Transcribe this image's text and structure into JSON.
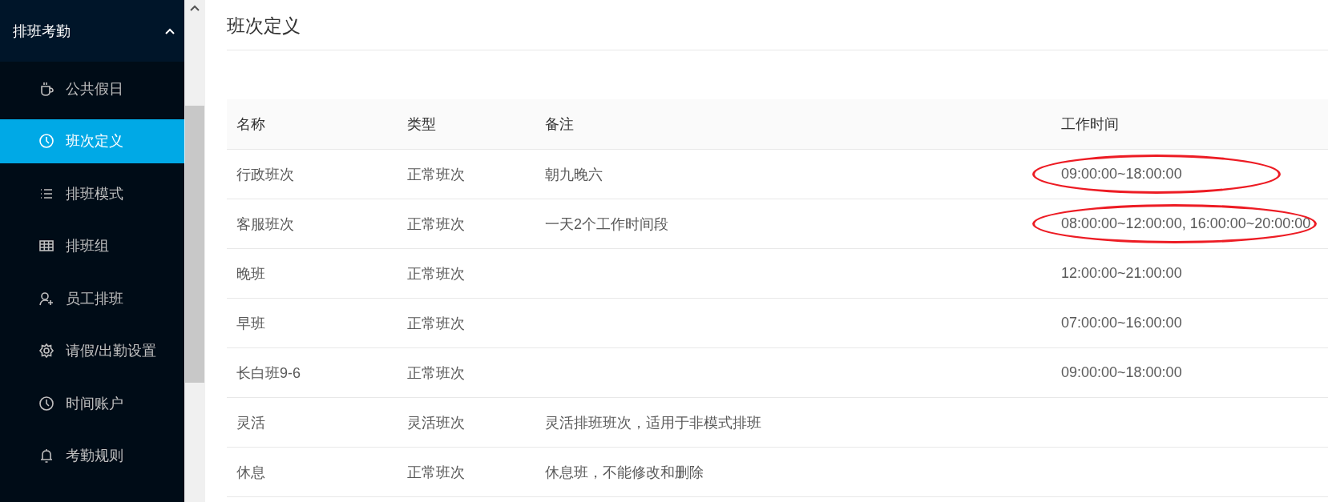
{
  "sidebar": {
    "group": {
      "label": "排班考勤",
      "expanded": true
    },
    "items": [
      {
        "label": "公共假日",
        "kind": "cup",
        "selected": false
      },
      {
        "label": "班次定义",
        "kind": "clock",
        "selected": true
      },
      {
        "label": "排班模式",
        "kind": "list",
        "selected": false
      },
      {
        "label": "排班组",
        "kind": "grid",
        "selected": false
      },
      {
        "label": "员工排班",
        "kind": "user",
        "selected": false
      },
      {
        "label": "请假/出勤设置",
        "kind": "gear",
        "selected": false
      },
      {
        "label": "时间账户",
        "kind": "clock",
        "selected": false
      },
      {
        "label": "考勤规则",
        "kind": "bell",
        "selected": false
      }
    ]
  },
  "page": {
    "title": "班次定义"
  },
  "table": {
    "columns": [
      "名称",
      "类型",
      "备注",
      "工作时间"
    ],
    "rows": [
      {
        "cells": [
          "行政班次",
          "正常班次",
          "朝九晚六",
          "09:00:00~18:00:00"
        ],
        "circled": true
      },
      {
        "cells": [
          "客服班次",
          "正常班次",
          "一天2个工作时间段",
          "08:00:00~12:00:00, 16:00:00~20:00:00"
        ],
        "circled": true
      },
      {
        "cells": [
          "晚班",
          "正常班次",
          "",
          "12:00:00~21:00:00"
        ],
        "circled": false
      },
      {
        "cells": [
          "早班",
          "正常班次",
          "",
          "07:00:00~16:00:00"
        ],
        "circled": false
      },
      {
        "cells": [
          "长白班9-6",
          "正常班次",
          "",
          "09:00:00~18:00:00"
        ],
        "circled": false
      },
      {
        "cells": [
          "灵活",
          "灵活班次",
          "灵活排班班次，适用于非模式排班",
          ""
        ],
        "circled": false
      },
      {
        "cells": [
          "休息",
          "正常班次",
          "休息班，不能修改和删除",
          ""
        ],
        "circled": false
      }
    ]
  }
}
